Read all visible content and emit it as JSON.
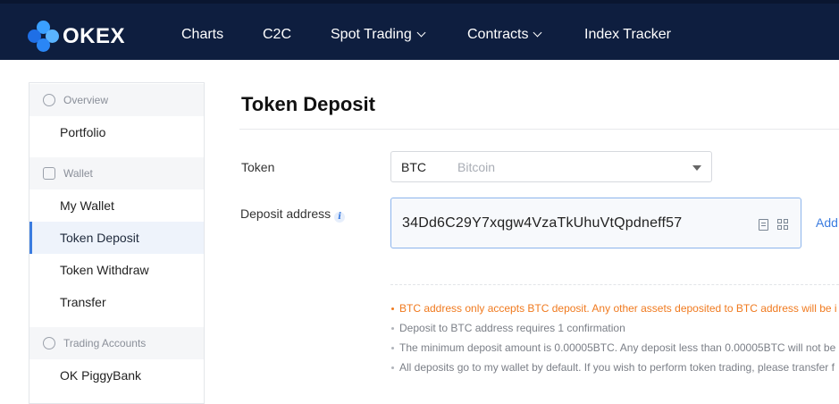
{
  "brand": {
    "name": "OKEX"
  },
  "nav": {
    "items": [
      {
        "label": "Charts",
        "dropdown": false
      },
      {
        "label": "C2C",
        "dropdown": false
      },
      {
        "label": "Spot Trading",
        "dropdown": true
      },
      {
        "label": "Contracts",
        "dropdown": true
      },
      {
        "label": "Index Tracker",
        "dropdown": false
      }
    ]
  },
  "sidebar": {
    "groups": [
      {
        "label": "Overview",
        "icon": "pie-chart-icon",
        "items": [
          "Portfolio"
        ]
      },
      {
        "label": "Wallet",
        "icon": "wallet-icon",
        "items": [
          "My Wallet",
          "Token Deposit",
          "Token Withdraw",
          "Transfer"
        ]
      },
      {
        "label": "Trading Accounts",
        "icon": "exchange-icon",
        "items": [
          "OK PiggyBank"
        ]
      }
    ],
    "active_item": "Token Deposit"
  },
  "main": {
    "title": "Token Deposit",
    "token_label": "Token",
    "token_symbol": "BTC",
    "token_name": "Bitcoin",
    "deposit_label": "Deposit address",
    "deposit_address": "34Dd6C29Y7xqgw4VzaTkUhuVtQpdneff57",
    "add_link": "Add",
    "notes": [
      {
        "text": "BTC address only accepts BTC deposit. Any other assets deposited to BTC address will be i",
        "warning": true
      },
      {
        "text": "Deposit to BTC address requires 1 confirmation",
        "warning": false
      },
      {
        "text": "The minimum deposit amount is 0.00005BTC. Any deposit less than 0.00005BTC will not be",
        "warning": false
      },
      {
        "text": "All deposits go to my wallet by default. If you wish to perform token trading, please transfer f",
        "warning": false
      }
    ]
  },
  "colors": {
    "topbar": "#0e1e3f",
    "accent": "#3b7ce0",
    "warning": "#f07a1f"
  }
}
